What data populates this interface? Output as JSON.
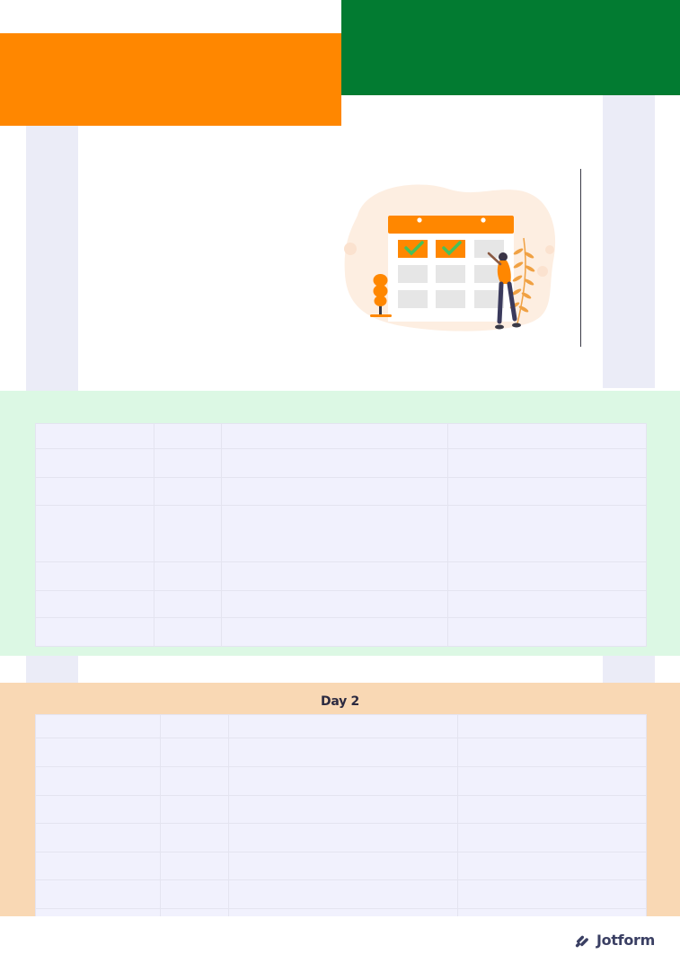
{
  "colors": {
    "orange": "#ff8700",
    "green": "#027b31",
    "lavender": "#ebecf7",
    "mint": "#dcf8e4",
    "peach": "#f9d8b4",
    "table_fill": "#f1f1fd"
  },
  "illustration": {
    "icon": "calendar-checklist-illustration"
  },
  "day1": {
    "title": "",
    "rows": 7,
    "columns": 4
  },
  "day2": {
    "title": "Day 2",
    "rows": 8,
    "columns": 4
  },
  "footer": {
    "brand": "Jotform",
    "icon": "jotform-logo-icon"
  }
}
